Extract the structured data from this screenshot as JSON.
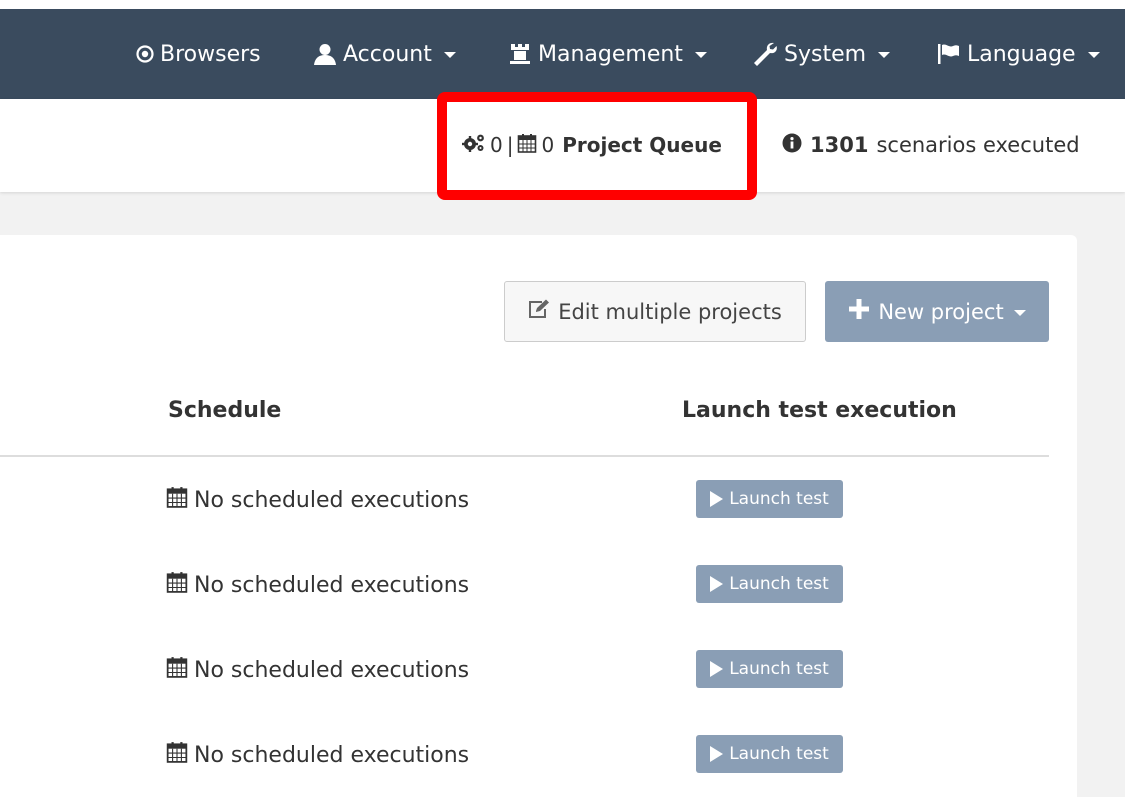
{
  "navbar": {
    "items": [
      {
        "label": "Browsers",
        "icon": "target-icon",
        "dropdown": false
      },
      {
        "label": "Account",
        "icon": "user-icon",
        "dropdown": true
      },
      {
        "label": "Management",
        "icon": "chess-rook-icon",
        "dropdown": true
      },
      {
        "label": "System",
        "icon": "wrench-icon",
        "dropdown": true
      },
      {
        "label": "Language",
        "icon": "flag-icon",
        "dropdown": true
      }
    ]
  },
  "status": {
    "running_count": "0",
    "separator": "|",
    "scheduled_count": "0",
    "queue_label": "Project Queue",
    "executed_count": "1301",
    "executed_label": "scenarios executed"
  },
  "toolbar": {
    "edit_multiple_label": "Edit multiple projects",
    "new_project_label": "New project"
  },
  "table": {
    "columns": [
      "Schedule",
      "Launch test execution"
    ],
    "rows": [
      {
        "schedule": "No scheduled executions",
        "launch_label": "Launch test"
      },
      {
        "schedule": "No scheduled executions",
        "launch_label": "Launch test"
      },
      {
        "schedule": "No scheduled executions",
        "launch_label": "Launch test"
      },
      {
        "schedule": "No scheduled executions",
        "launch_label": "Launch test"
      }
    ]
  },
  "colors": {
    "navbar_bg": "#3a4b5e",
    "button_primary": "#8a9eb5",
    "highlight": "#ff0000"
  }
}
